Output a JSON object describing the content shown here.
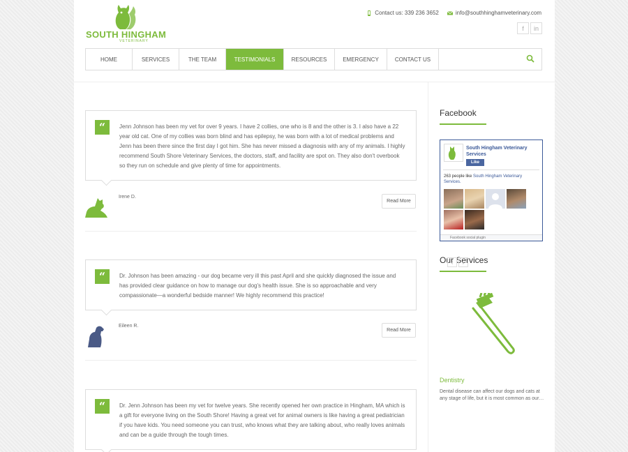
{
  "brand": {
    "name": "SOUTH HINGHAM",
    "tagline": "VETERINARY",
    "accent_color": "#7dbb3c"
  },
  "contact": {
    "phone_text": "Contact us: 339 236 3652",
    "email_text": "info@southhinghamveterinary.com",
    "phone_icon": "phone-icon",
    "email_icon": "envelope-icon"
  },
  "social": {
    "facebook": "f",
    "linkedin": "in"
  },
  "nav": {
    "items": [
      {
        "label": "HOME"
      },
      {
        "label": "SERVICES"
      },
      {
        "label": "THE TEAM"
      },
      {
        "label": "TESTIMONIALS",
        "active": true
      },
      {
        "label": "RESOURCES"
      },
      {
        "label": "EMERGENCY"
      },
      {
        "label": "CONTACT US"
      }
    ],
    "search_icon": "search-icon"
  },
  "testimonials": [
    {
      "text": "Jenn Johnson has been my vet for over 9 years. I have 2 collies, one who is 8 and the other is 3. I also have a 22 year old cat. One of my collies was born blind and has epilepsy, he was born with a lot of medical problems and Jenn has been there since the first day I got him. She has never missed a diagnosis with any of my animals. I highly recommend South Shore Veterinary Services, the doctors, staff, and facility are spot on. They also don't overbook so they run on schedule and give plenty of time for appointments.",
      "author": "Irene D.",
      "pet_icon": "cat-silhouette-icon",
      "pet_color": "#7dbb3c",
      "button": "Read More"
    },
    {
      "text": "Dr. Johnson has been amazing - our dog became very ill this past April and she quickly diagnosed the issue and has provided clear guidance on how to manage our dog's health issue. She is so approachable and very compassionate—a wonderful bedside manner! We highly recommend this practice!",
      "author": "Eileen R.",
      "pet_icon": "dog-silhouette-icon",
      "pet_color": "#4a5a86",
      "button": "Read More"
    },
    {
      "text": "Dr. Jenn Johnson has been my vet for twelve years. She recently opened her own practice in Hingham, MA which is a gift for everyone living on the South Shore! Having a great vet for animal owners is like having a great pediatrician if you have kids. You need someone you can trust, who knows what they are talking about, who really loves animals and can be a guide through the tough times."
    }
  ],
  "sidebar": {
    "facebook_title": "Facebook",
    "fb_widget": {
      "page_name": "South Hingham Veterinary Services",
      "like_label": "Like",
      "count_prefix": "263 people like ",
      "count_link": "South Hingham Veterinary Services.",
      "footer": "Facebook social plugin"
    },
    "services_title": "Our Services",
    "arrows": {
      "prev": "‹",
      "next": "›"
    },
    "service": {
      "title": "Dentistry",
      "text": "Dental disease can affect our dogs and cats at any stage of life, but it is most common as our…",
      "icon": "toothbrush-icon"
    }
  }
}
